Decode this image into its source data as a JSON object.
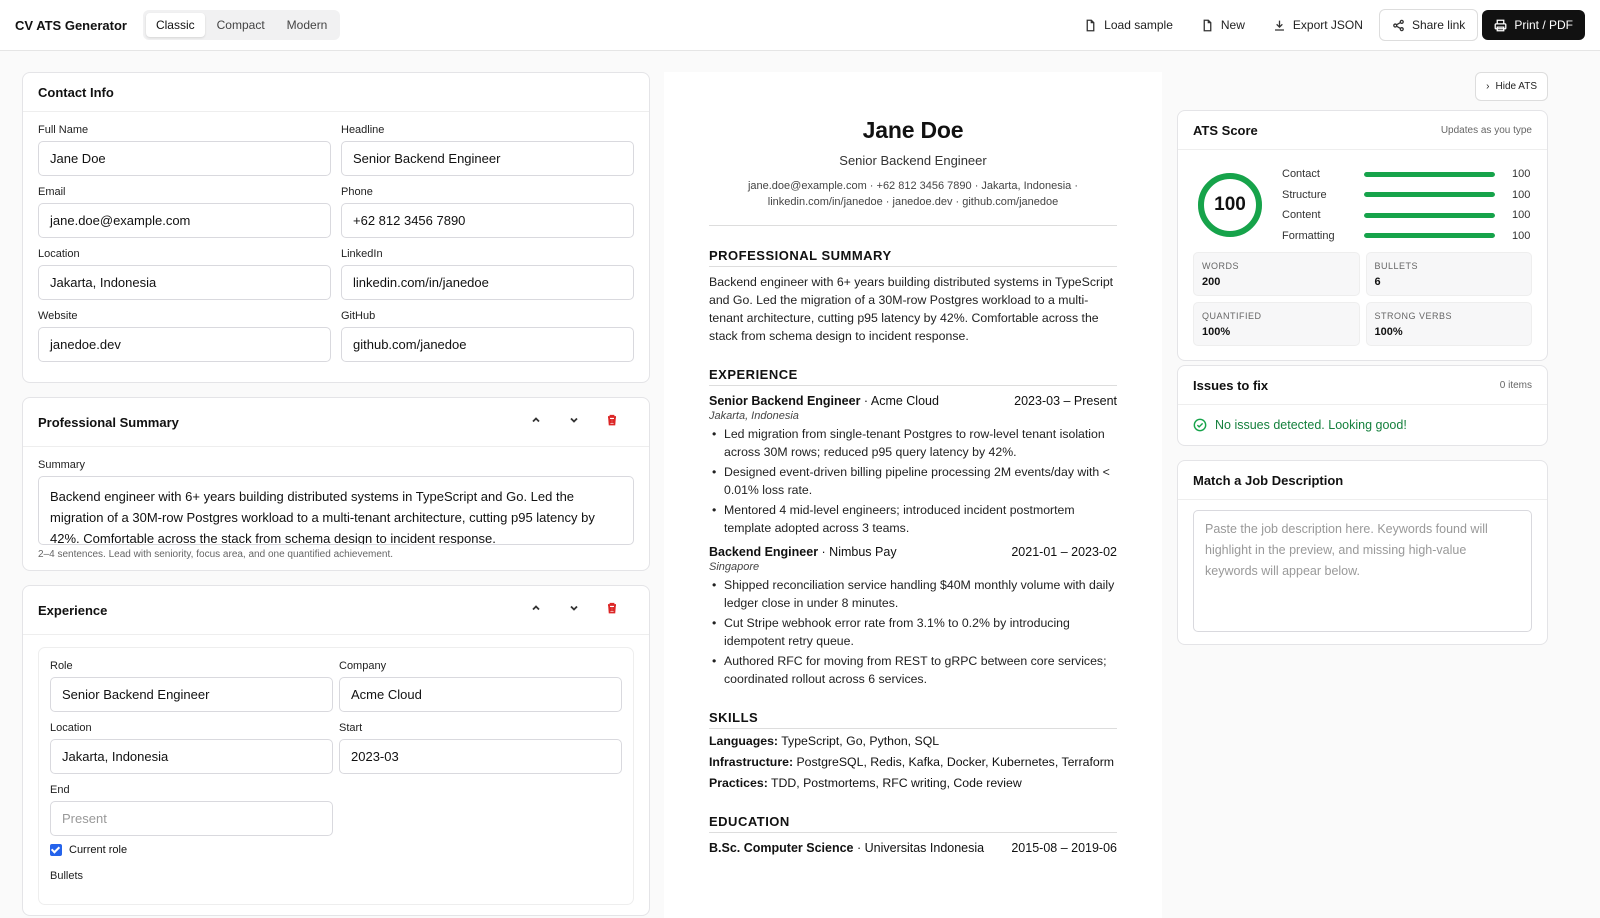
{
  "app": {
    "title": "CV ATS Generator",
    "templates": [
      "Classic",
      "Compact",
      "Modern"
    ],
    "active_template": "Classic",
    "actions": {
      "load_sample": "Load sample",
      "new": "New",
      "export_json": "Export JSON",
      "share_link": "Share link",
      "print_pdf": "Print / PDF"
    }
  },
  "contact": {
    "heading": "Contact Info",
    "full_name": {
      "label": "Full Name",
      "value": "Jane Doe"
    },
    "headline": {
      "label": "Headline",
      "value": "Senior Backend Engineer"
    },
    "email": {
      "label": "Email",
      "value": "jane.doe@example.com"
    },
    "phone": {
      "label": "Phone",
      "value": "+62 812 3456 7890"
    },
    "location": {
      "label": "Location",
      "value": "Jakarta, Indonesia"
    },
    "linkedin": {
      "label": "LinkedIn",
      "value": "linkedin.com/in/janedoe"
    },
    "website": {
      "label": "Website",
      "value": "janedoe.dev"
    },
    "github": {
      "label": "GitHub",
      "value": "github.com/janedoe"
    }
  },
  "summary": {
    "heading": "Professional Summary",
    "label": "Summary",
    "value": "Backend engineer with 6+ years building distributed systems in TypeScript and Go. Led the migration of a 30M-row Postgres workload to a multi-tenant architecture, cutting p95 latency by 42%. Comfortable across the stack from schema design to incident response.",
    "hint": "2–4 sentences. Lead with seniority, focus area, and one quantified achievement."
  },
  "experience_editor": {
    "heading": "Experience",
    "role": {
      "label": "Role",
      "value": "Senior Backend Engineer"
    },
    "company": {
      "label": "Company",
      "value": "Acme Cloud"
    },
    "location": {
      "label": "Location",
      "value": "Jakarta, Indonesia"
    },
    "start": {
      "label": "Start",
      "value": "2023-03"
    },
    "end": {
      "label": "End",
      "placeholder": "Present"
    },
    "current_role_label": "Current role",
    "current_role_checked": true,
    "bullets_label": "Bullets"
  },
  "preview": {
    "name": "Jane Doe",
    "headline": "Senior Backend Engineer",
    "contact_line1": "jane.doe@example.com · +62 812 3456 7890 · Jakarta, Indonesia ·",
    "contact_line2": "linkedin.com/in/janedoe · janedoe.dev · github.com/janedoe",
    "summary_heading": "PROFESSIONAL SUMMARY",
    "summary_text": "Backend engineer with 6+ years building distributed systems in TypeScript and Go. Led the migration of a 30M-row Postgres workload to a multi-tenant architecture, cutting p95 latency by 42%. Comfortable across the stack from schema design to incident response.",
    "experience_heading": "EXPERIENCE",
    "jobs": [
      {
        "role": "Senior Backend Engineer",
        "company": " · Acme Cloud",
        "dates": "2023-03 – Present",
        "location": "Jakarta, Indonesia",
        "bullets": [
          "Led migration from single-tenant Postgres to row-level tenant isolation across 30M rows; reduced p95 query latency by 42%.",
          "Designed event-driven billing pipeline processing 2M events/day with < 0.01% loss rate.",
          "Mentored 4 mid-level engineers; introduced incident postmortem template adopted across 3 teams."
        ]
      },
      {
        "role": "Backend Engineer",
        "company": " · Nimbus Pay",
        "dates": "2021-01 – 2023-02",
        "location": "Singapore",
        "bullets": [
          "Shipped reconciliation service handling $40M monthly volume with daily ledger close in under 8 minutes.",
          "Cut Stripe webhook error rate from 3.1% to 0.2% by introducing idempotent retry queue.",
          "Authored RFC for moving from REST to gRPC between core services; coordinated rollout across 6 services."
        ]
      }
    ],
    "skills_heading": "SKILLS",
    "skills": [
      {
        "label": "Languages:",
        "value": " TypeScript, Go, Python, SQL"
      },
      {
        "label": "Infrastructure:",
        "value": " PostgreSQL, Redis, Kafka, Docker, Kubernetes, Terraform"
      },
      {
        "label": "Practices:",
        "value": " TDD, Postmortems, RFC writing, Code review"
      }
    ],
    "education_heading": "EDUCATION",
    "education": {
      "degree": "B.Sc. Computer Science",
      "school": " · Universitas Indonesia",
      "dates": "2015-08 – 2019-06"
    }
  },
  "ats": {
    "hide_label": "Hide ATS",
    "heading": "ATS Score",
    "subtitle": "Updates as you type",
    "score": "100",
    "score_value": 100,
    "accent": "#16a34a",
    "breakdown": [
      {
        "label": "Contact",
        "value": "100",
        "fill": 1.0
      },
      {
        "label": "Structure",
        "value": "100",
        "fill": 1.0
      },
      {
        "label": "Content",
        "value": "100",
        "fill": 1.0
      },
      {
        "label": "Formatting",
        "value": "100",
        "fill": 1.0
      }
    ],
    "stats": [
      {
        "key": "WORDS",
        "value": "200"
      },
      {
        "key": "BULLETS",
        "value": "6"
      },
      {
        "key": "QUANTIFIED",
        "value": "100%"
      },
      {
        "key": "STRONG VERBS",
        "value": "100%"
      }
    ]
  },
  "issues": {
    "heading": "Issues to fix",
    "count": "0 items",
    "message": "No issues detected. Looking good!"
  },
  "job_match": {
    "heading": "Match a Job Description",
    "placeholder": "Paste the job description here. Keywords found will highlight in the preview, and missing high-value keywords will appear below."
  }
}
